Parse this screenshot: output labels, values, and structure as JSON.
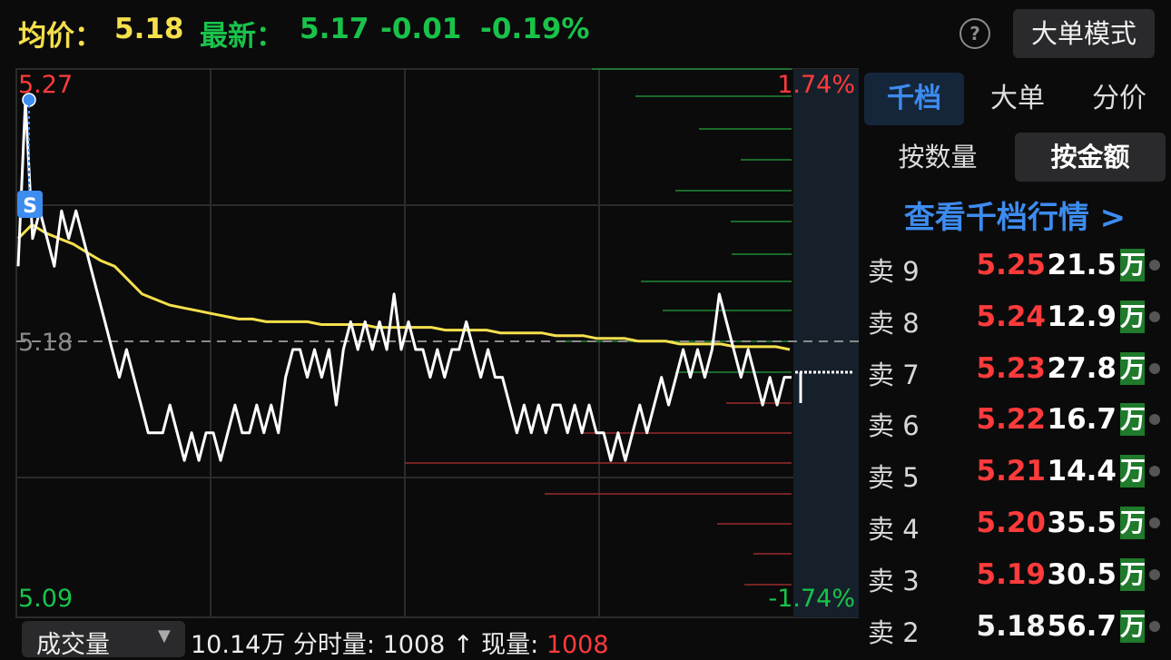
{
  "header": {
    "avg_label": "均价：",
    "avg_value": "5.18",
    "latest_label": "最新：",
    "latest_value": "5.17",
    "change": "-0.01",
    "change_pct": "-0.19%",
    "help_glyph": "?",
    "mode_button": "大单模式"
  },
  "chart": {
    "price_high": "5.27",
    "price_ref": "5.18",
    "price_low": "5.09",
    "pct_high": "1.74%",
    "pct_low": "-1.74%",
    "marker": "S",
    "colors": {
      "price_line": "#ffffff",
      "avg_line": "#f5e04c",
      "up": "#ff3b3b",
      "down": "#19c34a",
      "grid": "#2b2b2b"
    }
  },
  "chart_data": {
    "type": "line",
    "title": "",
    "ylim": [
      5.09,
      5.27
    ],
    "ref_price": 5.18,
    "series": [
      {
        "name": "price",
        "values": [
          5.21,
          5.27,
          5.22,
          5.23,
          5.22,
          5.21,
          5.23,
          5.22,
          5.23,
          5.22,
          5.21,
          5.2,
          5.19,
          5.18,
          5.17,
          5.18,
          5.17,
          5.16,
          5.15,
          5.15,
          5.15,
          5.16,
          5.15,
          5.14,
          5.15,
          5.14,
          5.15,
          5.15,
          5.14,
          5.15,
          5.16,
          5.15,
          5.15,
          5.16,
          5.15,
          5.16,
          5.15,
          5.17,
          5.18,
          5.18,
          5.17,
          5.18,
          5.17,
          5.18,
          5.16,
          5.18,
          5.19,
          5.18,
          5.19,
          5.18,
          5.19,
          5.18,
          5.2,
          5.18,
          5.19,
          5.18,
          5.18,
          5.17,
          5.18,
          5.17,
          5.18,
          5.18,
          5.19,
          5.18,
          5.17,
          5.18,
          5.17,
          5.17,
          5.16,
          5.15,
          5.16,
          5.15,
          5.16,
          5.15,
          5.16,
          5.16,
          5.15,
          5.16,
          5.15,
          5.16,
          5.15,
          5.15,
          5.14,
          5.15,
          5.14,
          5.15,
          5.16,
          5.15,
          5.16,
          5.17,
          5.16,
          5.17,
          5.18,
          5.17,
          5.18,
          5.17,
          5.18,
          5.2,
          5.19,
          5.18,
          5.17,
          5.18,
          5.17,
          5.16,
          5.17,
          5.16,
          5.17,
          5.17
        ]
      },
      {
        "name": "avg",
        "values": [
          5.22,
          5.225,
          5.222,
          5.22,
          5.218,
          5.215,
          5.212,
          5.21,
          5.205,
          5.2,
          5.198,
          5.196,
          5.195,
          5.194,
          5.193,
          5.192,
          5.191,
          5.191,
          5.19,
          5.19,
          5.19,
          5.19,
          5.189,
          5.189,
          5.189,
          5.189,
          5.188,
          5.188,
          5.188,
          5.188,
          5.188,
          5.187,
          5.187,
          5.187,
          5.187,
          5.186,
          5.186,
          5.186,
          5.186,
          5.185,
          5.185,
          5.185,
          5.184,
          5.184,
          5.184,
          5.183,
          5.183,
          5.183,
          5.182,
          5.182,
          5.182,
          5.182,
          5.181,
          5.181,
          5.181,
          5.181,
          5.18
        ]
      }
    ]
  },
  "side": {
    "tabs": [
      "千档",
      "大单",
      "分价"
    ],
    "seg": [
      "按数量",
      "按金额"
    ],
    "link": "查看千档行情 >",
    "rows": [
      {
        "label": "卖 9",
        "price": "5.25",
        "amount": "21.5",
        "unit": "万"
      },
      {
        "label": "卖 8",
        "price": "5.24",
        "amount": "12.9",
        "unit": "万"
      },
      {
        "label": "卖 7",
        "price": "5.23",
        "amount": "27.8",
        "unit": "万"
      },
      {
        "label": "卖 6",
        "price": "5.22",
        "amount": "16.7",
        "unit": "万"
      },
      {
        "label": "卖 5",
        "price": "5.21",
        "amount": "14.4",
        "unit": "万"
      },
      {
        "label": "卖 4",
        "price": "5.20",
        "amount": "35.5",
        "unit": "万"
      },
      {
        "label": "卖 3",
        "price": "5.19",
        "amount": "30.5",
        "unit": "万"
      },
      {
        "label": "卖 2",
        "price": "5.18",
        "amount": "56.7",
        "unit": "万"
      }
    ]
  },
  "bottom": {
    "selector": "成交量",
    "caret": "▼",
    "total": "10.14万",
    "minute_label": "分时量:",
    "minute_value": "1008",
    "arrow": "↑",
    "current_label": "现量:",
    "current_value": "1008"
  }
}
